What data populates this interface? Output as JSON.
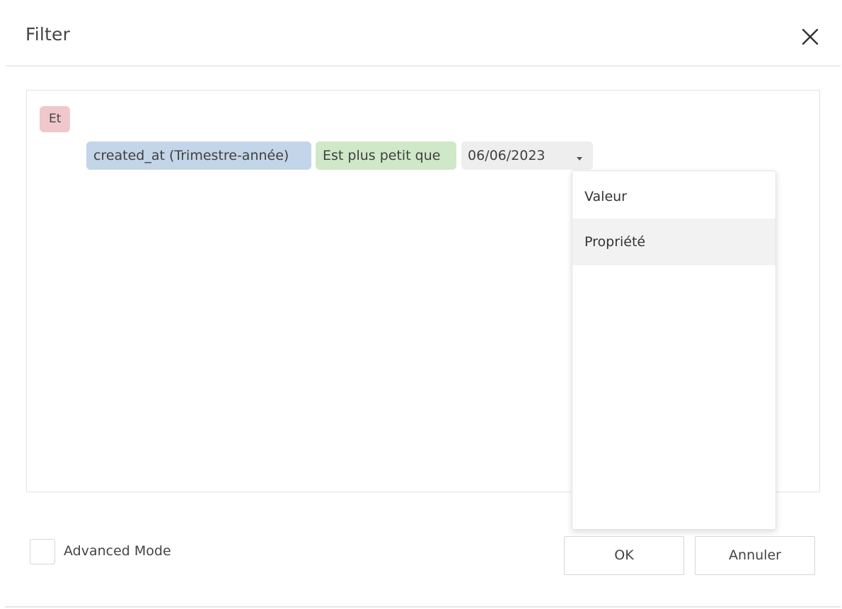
{
  "dialog": {
    "title": "Filter",
    "close_icon": "close-icon"
  },
  "builder": {
    "group_operator": "Et",
    "condition": {
      "field": "created_at (Trimestre-année)",
      "operator": "Est plus petit que",
      "value": "06/06/2023",
      "value_caret_icon": "caret-down-icon"
    },
    "value_type_dropdown": {
      "options": [
        "Valeur",
        "Propriété"
      ],
      "hovered": "Propriété"
    }
  },
  "footer": {
    "advanced_mode_label": "Advanced Mode",
    "advanced_mode_checked": false,
    "ok_label": "OK",
    "cancel_label": "Annuler"
  },
  "colors": {
    "group_chip": "#f0c8cc",
    "field_chip": "#c3d5e8",
    "operator_chip": "#cfe8c8",
    "value_chip": "#eeeeee"
  }
}
